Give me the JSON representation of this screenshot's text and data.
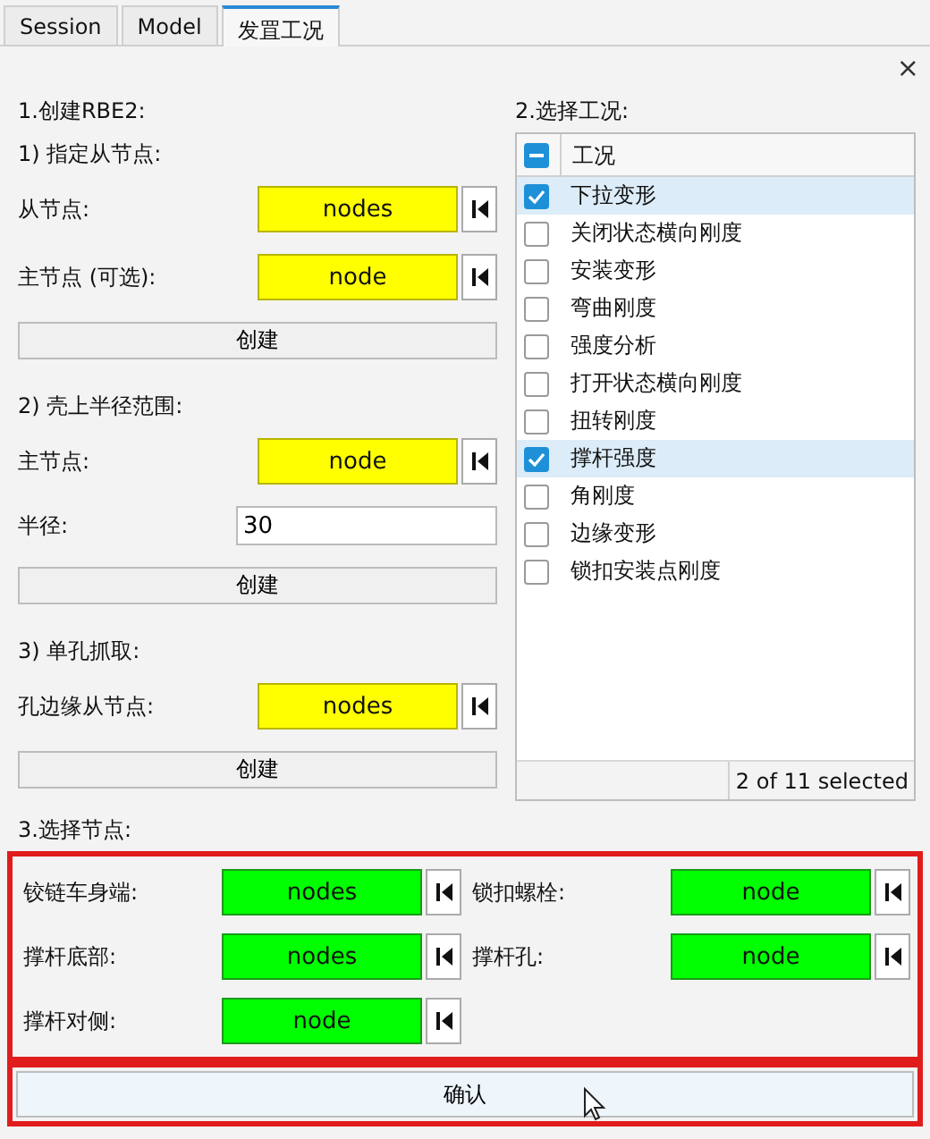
{
  "tabs": [
    {
      "label": "Session",
      "selected": false
    },
    {
      "label": "Model",
      "selected": false
    },
    {
      "label": "发罝工况",
      "selected": true
    }
  ],
  "close": "×",
  "create_rbe2": {
    "title": "1.创建RBE2:",
    "groups": [
      {
        "subtitle": "1) 指定从节点:",
        "fields": [
          {
            "kind": "selector",
            "label": "从节点:",
            "value": "nodes",
            "color": "#ffff00"
          },
          {
            "kind": "selector",
            "label": "主节点 (可选):",
            "value": "node",
            "color": "#ffff00"
          }
        ],
        "button": "创建"
      },
      {
        "subtitle": "2) 壳上半径范围:",
        "fields": [
          {
            "kind": "selector",
            "label": "主节点:",
            "value": "node",
            "color": "#ffff00"
          },
          {
            "kind": "text",
            "label": "半径:",
            "value": "30"
          }
        ],
        "button": "创建"
      },
      {
        "subtitle": "3) 单孔抓取:",
        "fields": [
          {
            "kind": "selector",
            "label": "孔边缘从节点:",
            "value": "nodes",
            "color": "#ffff00"
          }
        ],
        "button": "创建"
      }
    ]
  },
  "conditions": {
    "title": "2.选择工况:",
    "header": {
      "label": "工况",
      "partial": true
    },
    "items": [
      {
        "label": "下拉变形",
        "checked": true
      },
      {
        "label": "关闭状态横向刚度",
        "checked": false
      },
      {
        "label": "安装变形",
        "checked": false
      },
      {
        "label": "弯曲刚度",
        "checked": false
      },
      {
        "label": "强度分析",
        "checked": false
      },
      {
        "label": "打开状态横向刚度",
        "checked": false
      },
      {
        "label": "扭转刚度",
        "checked": false
      },
      {
        "label": "撑杆强度",
        "checked": true
      },
      {
        "label": "角刚度",
        "checked": false
      },
      {
        "label": "边缘变形",
        "checked": false
      },
      {
        "label": "锁扣安装点刚度",
        "checked": false
      }
    ],
    "footer": "2 of 11 selected"
  },
  "select_nodes": {
    "title": "3.选择节点:",
    "highlighted": true,
    "fields": [
      {
        "label": "铰链车身端:",
        "value": "nodes",
        "color": "#00ff00"
      },
      {
        "label": "锁扣螺栓:",
        "value": "node",
        "color": "#00ff00"
      },
      {
        "label": "撑杆底部:",
        "value": "nodes",
        "color": "#00ff00"
      },
      {
        "label": "撑杆孔:",
        "value": "node",
        "color": "#00ff00"
      },
      {
        "label": "撑杆对侧:",
        "value": "node",
        "color": "#00ff00"
      }
    ]
  },
  "confirm": {
    "label": "确认",
    "highlighted": true
  }
}
